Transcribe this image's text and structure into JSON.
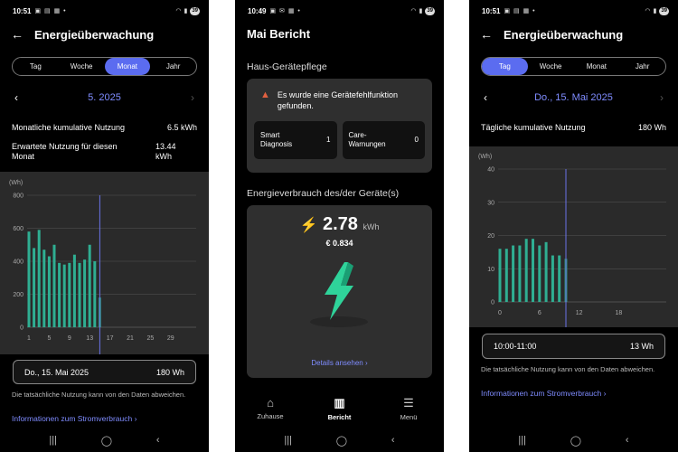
{
  "status": {
    "left": {
      "time": "10:51",
      "icons": "▣ ▤ ▦ •",
      "battery": "39"
    },
    "middle": {
      "time": "10:49",
      "icons": "▣ ✉ ▦ •",
      "battery": "39"
    },
    "right": {
      "time": "10:51",
      "icons": "▣ ▤ ▦ •",
      "battery": "39"
    }
  },
  "screen_month": {
    "title": "Energieüberwachung",
    "segments": [
      "Tag",
      "Woche",
      "Monat",
      "Jahr"
    ],
    "active_segment": "Monat",
    "period_label": "5. 2025",
    "row1_label": "Monatliche kumulative Nutzung",
    "row1_value": "6.5 kWh",
    "row2_label_a": "Erwartete Nutzung für diesen",
    "row2_label_b": "Monat",
    "row2_value_a": "13.44",
    "row2_value_b": "kWh",
    "unit": "(Wh)",
    "tooltip_label": "Do., 15. Mai 2025",
    "tooltip_value": "180 Wh",
    "note": "Die tatsächliche Nutzung kann von den Daten abweichen.",
    "link": "Informationen zum Stromverbrauch ›"
  },
  "screen_report": {
    "title": "Mai Bericht",
    "section1": "Haus-Gerätepflege",
    "warning_a": "Es wurde eine Gerätefehlfunktion",
    "warning_b": "gefunden.",
    "mini1_label_a": "Smart",
    "mini1_label_b": "Diagnosis",
    "mini1_value": "1",
    "mini2_label_a": "Care-",
    "mini2_label_b": "Warnungen",
    "mini2_value": "0",
    "section2": "Energieverbrauch des/der Geräte(s)",
    "energy_value": "2.78",
    "energy_unit": "kWh",
    "cost": "€ 0.834",
    "details_link": "Details ansehen ›",
    "tabs": [
      {
        "label": "Zuhause",
        "icon": "⌂"
      },
      {
        "label": "Bericht",
        "icon": "▥"
      },
      {
        "label": "Menü",
        "icon": "☰"
      }
    ]
  },
  "screen_day": {
    "title": "Energieüberwachung",
    "segments": [
      "Tag",
      "Woche",
      "Monat",
      "Jahr"
    ],
    "active_segment": "Tag",
    "period_label": "Do., 15. Mai 2025",
    "row1_label": "Tägliche kumulative Nutzung",
    "row1_value": "180 Wh",
    "unit": "(Wh)",
    "tooltip_label": "10:00-11:00",
    "tooltip_value": "13 Wh",
    "note": "Die tatsächliche Nutzung kann von den Daten abweichen.",
    "link": "Informationen zum Stromverbrauch ›"
  },
  "system_nav": {
    "recents": "|||",
    "home": "◯",
    "back": "‹"
  },
  "colors": {
    "accent": "#5b6cf0",
    "bar": "#2fae92",
    "link": "#7f8cff",
    "warning": "#e06040"
  },
  "chart_data": [
    {
      "type": "bar",
      "title": "",
      "ylabel": "(Wh)",
      "ylim": [
        0,
        800
      ],
      "yticks": [
        0,
        200,
        400,
        600,
        800
      ],
      "xticks": [
        1,
        5,
        9,
        13,
        17,
        21,
        25,
        29
      ],
      "x": [
        1,
        2,
        3,
        4,
        5,
        6,
        7,
        8,
        9,
        10,
        11,
        12,
        13,
        14,
        15
      ],
      "values": [
        580,
        480,
        590,
        470,
        430,
        500,
        390,
        380,
        390,
        440,
        390,
        410,
        500,
        400,
        180
      ],
      "highlight_x": 15
    },
    {
      "type": "bar",
      "title": "",
      "ylabel": "(Wh)",
      "ylim": [
        0,
        40
      ],
      "yticks": [
        0,
        10,
        20,
        30,
        40
      ],
      "xticks": [
        0,
        6,
        12,
        18
      ],
      "x": [
        0,
        1,
        2,
        3,
        4,
        5,
        6,
        7,
        8,
        9,
        10
      ],
      "values": [
        16,
        16,
        17,
        17,
        19,
        19,
        17,
        18,
        14,
        14,
        13
      ],
      "highlight_x": 10
    }
  ]
}
